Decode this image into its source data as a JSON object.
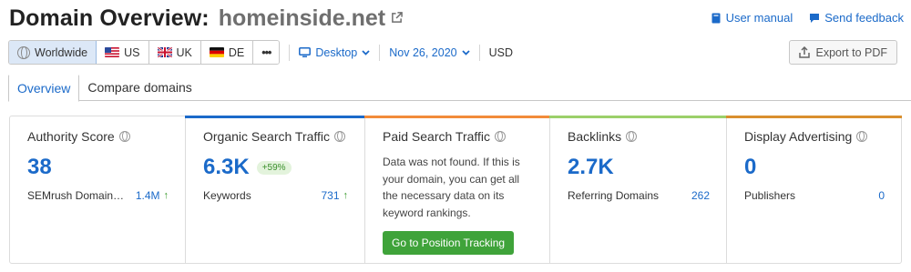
{
  "header": {
    "title": "Domain Overview:",
    "domain": "homeinside.net"
  },
  "top_links": [
    {
      "label": "User manual",
      "icon": "book-icon"
    },
    {
      "label": "Send feedback",
      "icon": "chat-icon"
    }
  ],
  "databases": [
    {
      "label": "Worldwide",
      "icon": "globe-icon",
      "active": true
    },
    {
      "label": "US",
      "icon": "flag-us-icon",
      "active": false
    },
    {
      "label": "UK",
      "icon": "flag-uk-icon",
      "active": false
    },
    {
      "label": "DE",
      "icon": "flag-de-icon",
      "active": false
    },
    {
      "label": "•••",
      "icon": "more-icon",
      "active": false
    }
  ],
  "toolbar": {
    "device": "Desktop",
    "date": "Nov 26, 2020",
    "currency": "USD",
    "export_label": "Export to PDF"
  },
  "tabs": [
    {
      "label": "Overview",
      "active": true
    },
    {
      "label": "Compare domains",
      "active": false
    }
  ],
  "colors": {
    "accent": "#1b6ac9",
    "organic_bar": "#1b6ac9",
    "paid_bar": "#f28b3a",
    "backlinks_bar": "#9bd06a",
    "display_bar": "#d98f2e",
    "positive": "#3a9b2e",
    "cta": "#3fa33a"
  },
  "cards": {
    "authority": {
      "title": "Authority Score",
      "value": "38",
      "metric_label": "SEMrush Domain…",
      "metric_value": "1.4M",
      "metric_trend": "↑"
    },
    "organic": {
      "title": "Organic Search Traffic",
      "value": "6.3K",
      "change": "+59%",
      "metric_label": "Keywords",
      "metric_value": "731",
      "metric_trend": "↑"
    },
    "paid": {
      "title": "Paid Search Traffic",
      "description": "Data was not found. If this is your domain, you can get all the necessary data on its keyword rankings.",
      "cta": "Go to Position Tracking"
    },
    "backlinks": {
      "title": "Backlinks",
      "value": "2.7K",
      "metric_label": "Referring Domains",
      "metric_value": "262"
    },
    "display": {
      "title": "Display Advertising",
      "value": "0",
      "metric_label": "Publishers",
      "metric_value": "0"
    }
  }
}
